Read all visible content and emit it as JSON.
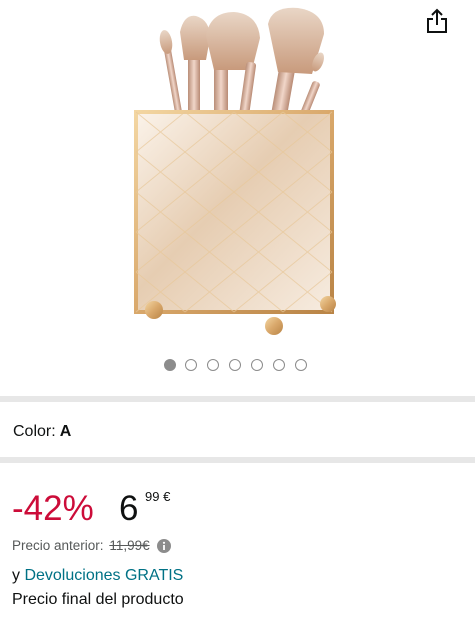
{
  "gallery": {
    "image_alt": "Portabrochas de cristal dorado con brochas de maquillaje",
    "image_count": 7,
    "active_index": 0,
    "share_icon": "share-icon"
  },
  "variant": {
    "label": "Color:",
    "value": "A"
  },
  "price": {
    "discount": "-42%",
    "whole": "6",
    "fraction": "99",
    "currency": "€",
    "previous_label": "Precio anterior:",
    "previous_value": "11,99€",
    "info_icon": "info-icon"
  },
  "returns": {
    "prefix": "y",
    "link": "Devoluciones GRATIS"
  },
  "final_price_note": "Precio final del producto",
  "colors": {
    "discount": "#cc0c39",
    "link": "#007185",
    "secondary_text": "#565959",
    "divider": "#e7e7e7",
    "dot": "#8c8c8c",
    "gold": "#d9a86b"
  }
}
